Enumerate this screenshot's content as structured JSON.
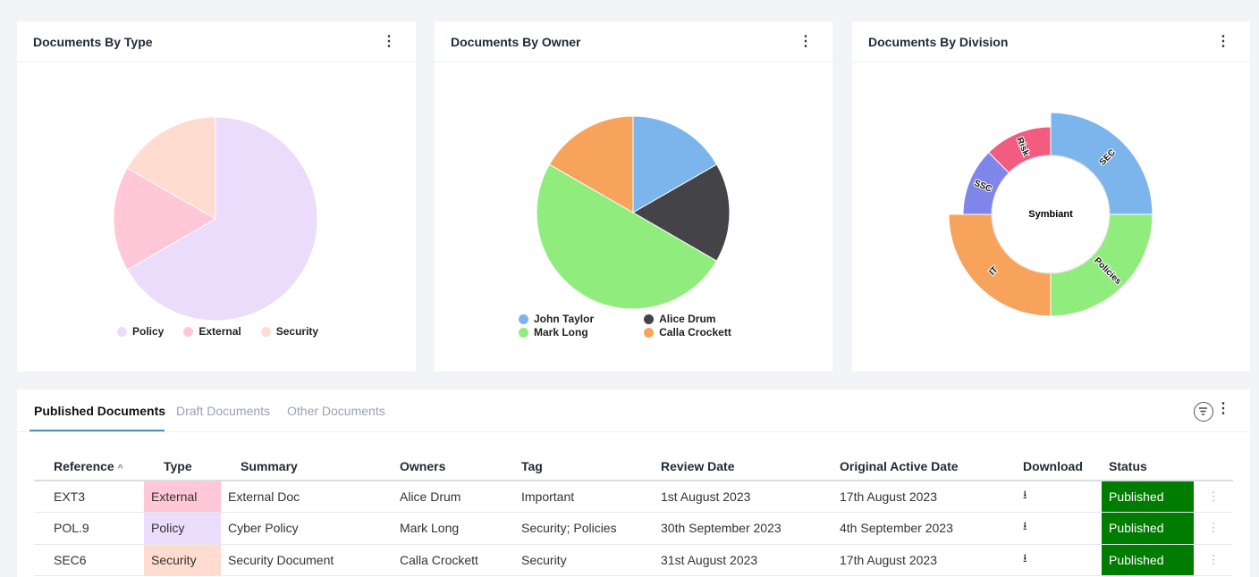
{
  "cards": {
    "type": {
      "title": "Documents By Type",
      "legend": [
        {
          "label": "Policy",
          "color": "#ecdcfb"
        },
        {
          "label": "External",
          "color": "#ffc7d8"
        },
        {
          "label": "Security",
          "color": "#ffdccf"
        }
      ]
    },
    "owner": {
      "title": "Documents By Owner",
      "legend": [
        {
          "label": "John Taylor",
          "color": "#7cb5ec"
        },
        {
          "label": "Alice Drum",
          "color": "#434348"
        },
        {
          "label": "Mark Long",
          "color": "#90ed7d"
        },
        {
          "label": "Calla Crockett",
          "color": "#f7a35c"
        }
      ]
    },
    "division": {
      "title": "Documents By Division",
      "center_label": "Symbiant"
    }
  },
  "chart_data": [
    {
      "type": "pie",
      "title": "Documents By Type",
      "categories": [
        "Policy",
        "External",
        "Security"
      ],
      "values": [
        66.7,
        16.7,
        16.7
      ],
      "colors": [
        "#ecdcfb",
        "#ffc7d8",
        "#ffdccf"
      ],
      "legend": "bottom"
    },
    {
      "type": "pie",
      "title": "Documents By Owner",
      "categories": [
        "John Taylor",
        "Alice Drum",
        "Mark Long",
        "Calla Crockett"
      ],
      "values": [
        16.7,
        16.7,
        50,
        16.7
      ],
      "colors": [
        "#7cb5ec",
        "#434348",
        "#90ed7d",
        "#f7a35c"
      ],
      "legend": "bottom"
    },
    {
      "type": "pie",
      "title": "Documents By Division",
      "center": "Symbiant",
      "categories": [
        "SEC",
        "Policies",
        "IT",
        "SSC",
        "Risk"
      ],
      "values": [
        2,
        2,
        2,
        1,
        1
      ],
      "colors": [
        "#7cb5ec",
        "#90ed7d",
        "#f7a35c",
        "#8085e9",
        "#f15c80"
      ]
    }
  ],
  "table": {
    "tabs": [
      "Published Documents",
      "Draft Documents",
      "Other Documents"
    ],
    "columns": [
      "Reference",
      "Type",
      "Summary",
      "Owners",
      "Tag",
      "Review Date",
      "Original Active Date",
      "Download",
      "Status"
    ],
    "sort_indicator": "^",
    "rows": [
      {
        "reference": "EXT3",
        "type": "External",
        "summary": "External Doc",
        "owners": "Alice Drum",
        "tag": "Important",
        "review_date": "1st August 2023",
        "active_date": "17th August 2023",
        "status": "Published"
      },
      {
        "reference": "POL.9",
        "type": "Policy",
        "summary": "Cyber Policy",
        "owners": "Mark Long",
        "tag": "Security; Policies",
        "review_date": "30th September 2023",
        "active_date": "4th September 2023",
        "status": "Published"
      },
      {
        "reference": "SEC6",
        "type": "Security",
        "summary": "Security Document",
        "owners": "Calla Crockett",
        "tag": "Security",
        "review_date": "31st August 2023",
        "active_date": "17th August 2023",
        "status": "Published"
      }
    ]
  },
  "icons": {
    "download": "download-icon",
    "filter": "filter-icon",
    "kebab": "kebab-icon"
  }
}
